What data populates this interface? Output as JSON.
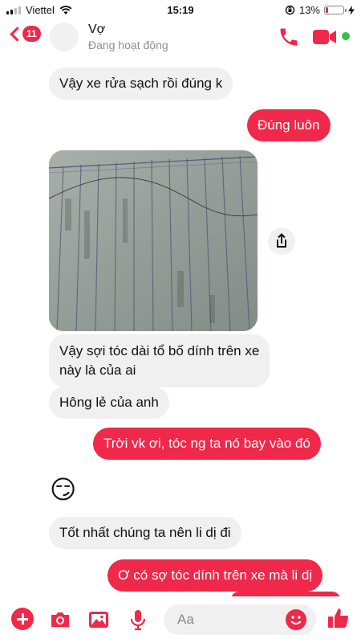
{
  "status_bar": {
    "carrier": "Viettel",
    "time": "15:19",
    "battery": "13%",
    "battery_level": 0.13,
    "icons": [
      "signal-icon",
      "wifi-icon",
      "rotation-lock-icon",
      "battery-icon",
      "charging-icon"
    ]
  },
  "header": {
    "back_count": "11",
    "contact_name": "Vợ",
    "contact_status": "Đang hoạt động",
    "accent_color": "#f02849",
    "online_color": "#31c14a"
  },
  "messages": [
    {
      "from": "them",
      "text": "Vậy xe rửa sạch rồi đúng k"
    },
    {
      "from": "me",
      "text": "Đúng luôn"
    },
    {
      "from": "them",
      "type": "photo"
    },
    {
      "from": "them",
      "text_line1": "Vậy sợi tóc dài tổ bố dính trên xe",
      "text_line2": "này là của ai"
    },
    {
      "from": "them",
      "text": "Hông lẻ của anh"
    },
    {
      "from": "me",
      "text": "Trời vk ơi, tóc ng ta nó bay vào đó"
    },
    {
      "from": "them",
      "emoji": "😏"
    },
    {
      "from": "them",
      "text": "Tốt nhất chúng ta nên li dị đi"
    },
    {
      "from": "me",
      "text": "Ơ có sợ tóc dính trên xe mà li dị"
    }
  ],
  "composer": {
    "placeholder": "Aa",
    "icons": [
      "add-icon",
      "camera-icon",
      "gallery-icon",
      "microphone-icon",
      "emoji-icon",
      "like-icon"
    ]
  }
}
